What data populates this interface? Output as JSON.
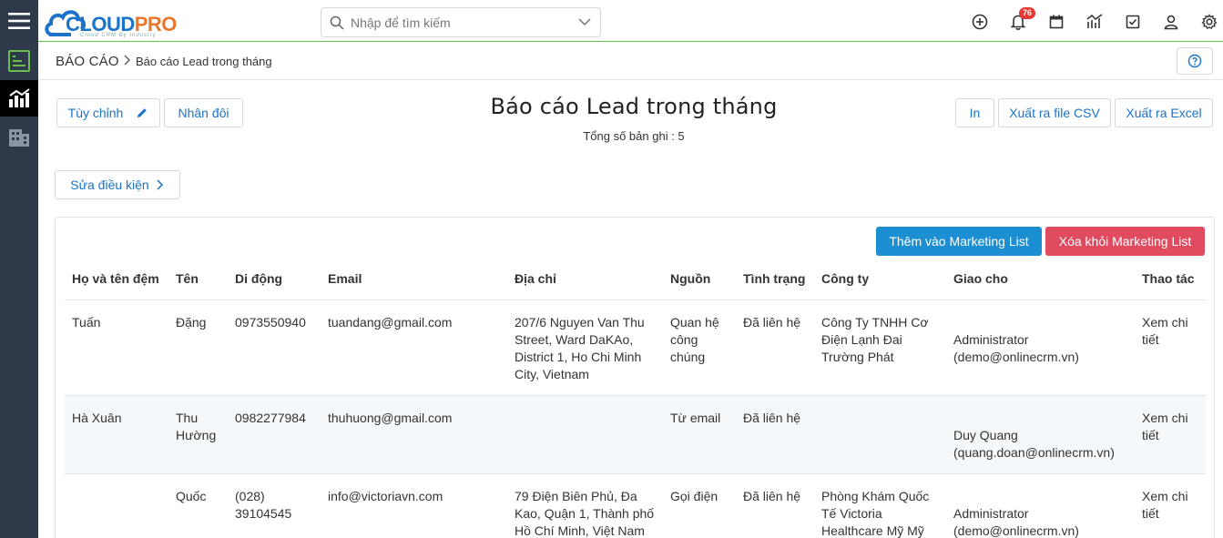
{
  "app": {
    "logo_main_1": "CLOUD",
    "logo_main_2": "PRO",
    "logo_sub": "Cloud CRM By Industry"
  },
  "search": {
    "placeholder": "Nhập để tìm kiếm"
  },
  "notifications": {
    "count": "76"
  },
  "breadcrumb": {
    "root": "BÁO CÁO",
    "current": "Báo cáo Lead trong tháng"
  },
  "toolbar": {
    "customize_label": "Tùy chỉnh",
    "duplicate_label": "Nhân đôi",
    "print_label": "In",
    "export_csv_label": "Xuất ra file CSV",
    "export_excel_label": "Xuất ra Excel",
    "edit_conditions_label": "Sửa điều kiện"
  },
  "report": {
    "title": "Báo cáo Lead trong tháng",
    "total_label": "Tổng số bản ghi : 5"
  },
  "marketing": {
    "add_label": "Thêm vào Marketing List",
    "remove_label": "Xóa khỏi Marketing List"
  },
  "colors": {
    "accent": "#1a73c9",
    "add_button": "#1b8fd1",
    "remove_button": "#e04b5f",
    "rail": "#2e3a4a"
  },
  "table": {
    "headers": [
      "Họ và tên đệm",
      "Tên",
      "Di động",
      "Email",
      "Địa chỉ",
      "Nguồn",
      "Tình trạng",
      "Công ty",
      "Giao cho",
      "Thao tác"
    ],
    "rows": [
      {
        "middle_name": "Tuấn",
        "first_name": "Đặng",
        "mobile": "0973550940",
        "email": "tuandang@gmail.com",
        "address": "207/6 Nguyen Van Thu Street, Ward DaKAo, District 1, Ho Chi Minh City, Vietnam",
        "source": "Quan hệ công chúng",
        "status": "Đã liên hệ",
        "company": "Công Ty TNHH Cơ Điện Lạnh Đai Trường Phát",
        "assigned": "Administrator (demo@onlinecrm.vn)",
        "action": "Xem chi tiết"
      },
      {
        "middle_name": "Hà Xuân",
        "first_name": "Thu Hường",
        "mobile": "0982277984",
        "email": "thuhuong@gmail.com",
        "address": "",
        "source": "Từ email",
        "status": "Đã liên hệ",
        "company": "",
        "assigned": "Duy Quang (quang.doan@onlinecrm.vn)",
        "action": "Xem chi tiết"
      },
      {
        "middle_name": "",
        "first_name": "Quốc",
        "mobile": "(028) 39104545",
        "email": "info@victoriavn.com",
        "address": "79 Điện Biên Phủ, Đa Kao, Quận 1, Thành phố Hồ Chí Minh, Việt Nam",
        "source": "Gọi điện",
        "status": "Đã liên hệ",
        "company": "Phòng Khám Quốc Tế Victoria Healthcare Mỹ Mỹ",
        "assigned": "Administrator (demo@onlinecrm.vn)",
        "action": "Xem chi tiết"
      }
    ]
  }
}
